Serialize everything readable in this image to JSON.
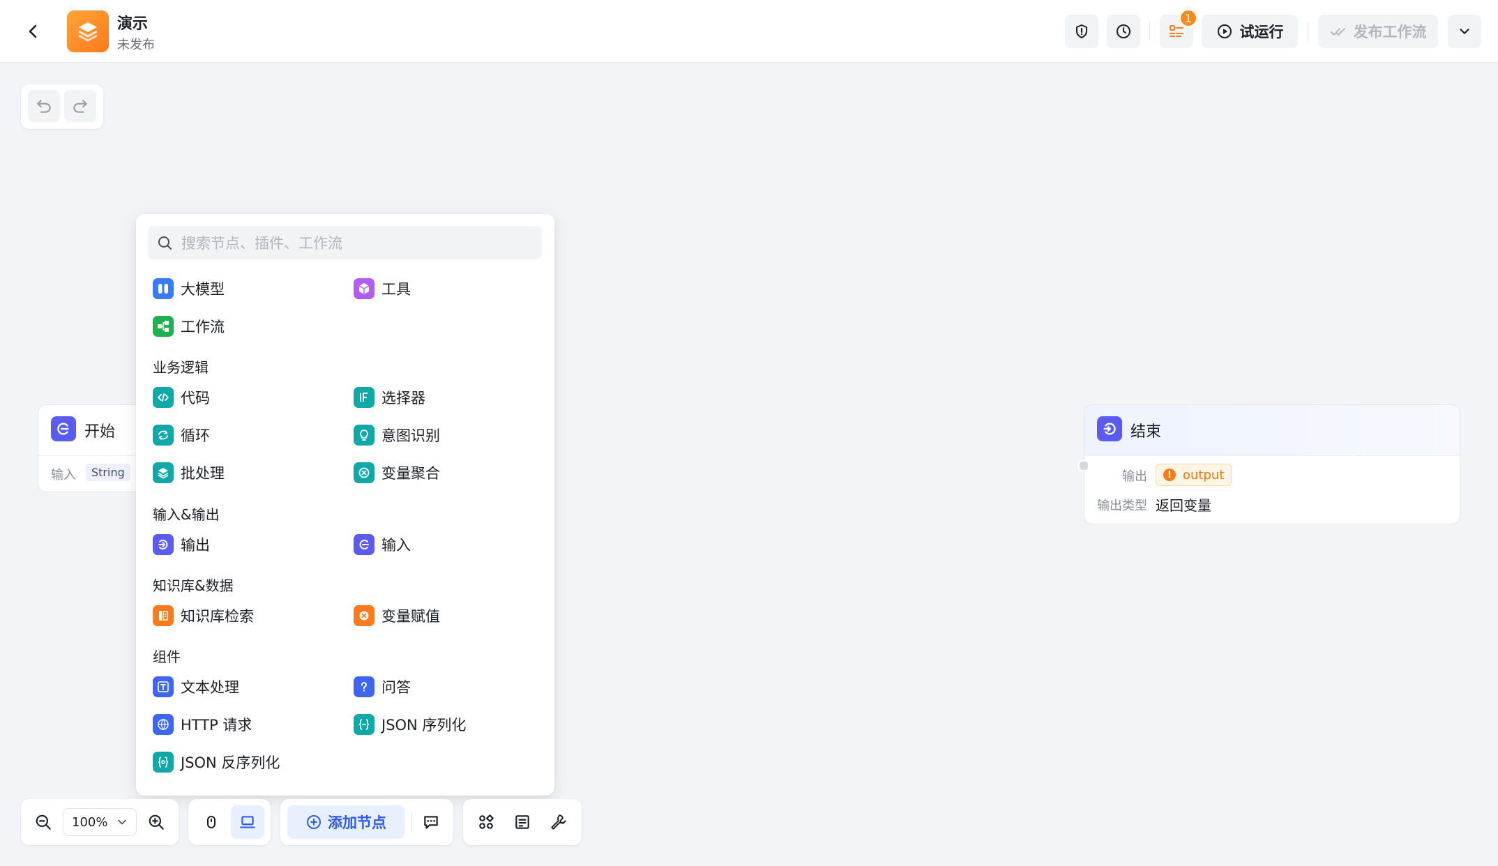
{
  "header": {
    "app_title": "演示",
    "app_status": "未发布",
    "run_label": "试运行",
    "publish_label": "发布工作流",
    "task_badge": "1"
  },
  "nodes": {
    "start": {
      "title": "开始",
      "input_label": "输入",
      "input_type": "String"
    },
    "end": {
      "title": "结束",
      "output_label": "输出",
      "output_var": "output",
      "output_type_label": "输出类型",
      "output_type_value": "返回变量"
    }
  },
  "picker": {
    "search_placeholder": "搜索节点、插件、工作流",
    "top_items": [
      {
        "label": "大模型",
        "icon": "brain-icon"
      },
      {
        "label": "工具",
        "icon": "cube-icon"
      },
      {
        "label": "工作流",
        "icon": "workflow-icon"
      }
    ],
    "sections": [
      {
        "title": "业务逻辑",
        "items": [
          {
            "label": "代码",
            "icon": "code-icon"
          },
          {
            "label": "选择器",
            "icon": "if-icon"
          },
          {
            "label": "循环",
            "icon": "loop-icon"
          },
          {
            "label": "意图识别",
            "icon": "bulb-icon"
          },
          {
            "label": "批处理",
            "icon": "layers-icon"
          },
          {
            "label": "变量聚合",
            "icon": "aggregate-icon"
          }
        ]
      },
      {
        "title": "输入&输出",
        "items": [
          {
            "label": "输出",
            "icon": "output-icon"
          },
          {
            "label": "输入",
            "icon": "input-icon"
          }
        ]
      },
      {
        "title": "知识库&数据",
        "items": [
          {
            "label": "知识库检索",
            "icon": "knowledge-icon"
          },
          {
            "label": "变量赋值",
            "icon": "assign-icon"
          }
        ]
      },
      {
        "title": "组件",
        "items": [
          {
            "label": "文本处理",
            "icon": "text-icon"
          },
          {
            "label": "问答",
            "icon": "question-icon"
          },
          {
            "label": "HTTP 请求",
            "icon": "http-icon"
          },
          {
            "label": "JSON 序列化",
            "icon": "json-icon"
          },
          {
            "label": "JSON 反序列化",
            "icon": "json-icon"
          }
        ]
      }
    ]
  },
  "toolbar": {
    "zoom": "100%",
    "add_node_label": "添加节点"
  },
  "colors": {
    "accent": "#2f5bea",
    "node_indigo": "#5a5cf0",
    "warning": "#ff7a1a"
  }
}
